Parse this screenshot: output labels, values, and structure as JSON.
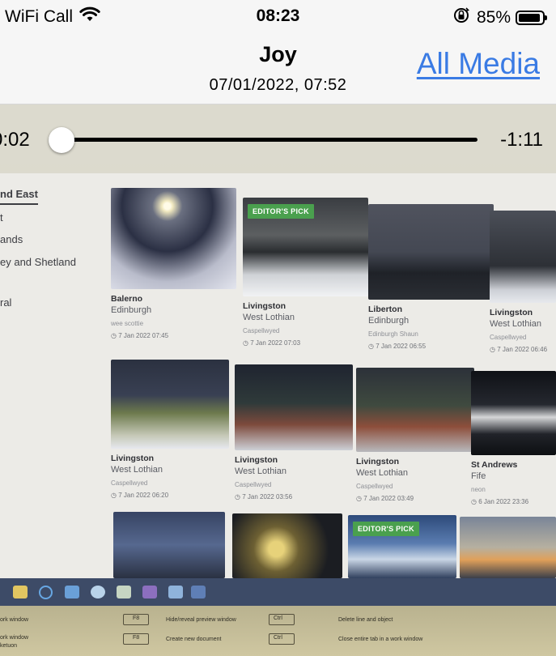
{
  "status_bar": {
    "carrier": "WiFi Call",
    "time": "08:23",
    "battery": "85%"
  },
  "nav": {
    "title": "Joy",
    "subtitle": "07/01/2022, 07:52",
    "all_media_label": "All Media"
  },
  "player": {
    "elapsed": "0:02",
    "remaining": "-1:11",
    "progress": 0.03
  },
  "filmed_page": {
    "sidebar": [
      "nd East",
      "t",
      "ands",
      "ey and Shetland",
      "ral"
    ],
    "cards": [
      {
        "place": "Balerno",
        "region": "Edinburgh",
        "user": "wee scottie",
        "stamp": "7 Jan 2022 07:45",
        "badge": ""
      },
      {
        "place": "Livingston",
        "region": "West Lothian",
        "user": "Caspellwyed",
        "stamp": "7 Jan 2022 07:03",
        "badge": "EDITOR'S PICK"
      },
      {
        "place": "Liberton",
        "region": "Edinburgh",
        "user": "Edinburgh Shaun",
        "stamp": "7 Jan 2022 06:55",
        "badge": ""
      },
      {
        "place": "Livingston",
        "region": "West Lothian",
        "user": "Caspellwyed",
        "stamp": "7 Jan 2022 06:46",
        "badge": ""
      },
      {
        "place": "Livingston",
        "region": "West Lothian",
        "user": "Caspellwyed",
        "stamp": "7 Jan 2022 06:20",
        "badge": ""
      },
      {
        "place": "Livingston",
        "region": "West Lothian",
        "user": "Caspellwyed",
        "stamp": "7 Jan 2022 03:56",
        "badge": ""
      },
      {
        "place": "Livingston",
        "region": "West Lothian",
        "user": "Caspellwyed",
        "stamp": "7 Jan 2022 03:49",
        "badge": ""
      },
      {
        "place": "St Andrews",
        "region": "Fife",
        "user": "neon",
        "stamp": "6 Jan 2022 23:36",
        "badge": ""
      },
      {
        "place": "",
        "region": "",
        "user": "",
        "stamp": "",
        "badge": ""
      },
      {
        "place": "",
        "region": "",
        "user": "",
        "stamp": "",
        "badge": ""
      },
      {
        "place": "",
        "region": "",
        "user": "",
        "stamp": "",
        "badge": "EDITOR'S PICK"
      },
      {
        "place": "",
        "region": "",
        "user": "",
        "stamp": "",
        "badge": ""
      }
    ]
  },
  "keyboard_labels": [
    "ork window",
    "ork window",
    "ketuon",
    "F8",
    "F8",
    "Hide/reveal preview window",
    "Create new document",
    "Ctrl",
    "Ctrl",
    "Delete line and object",
    "Close entire tab in a work window"
  ]
}
